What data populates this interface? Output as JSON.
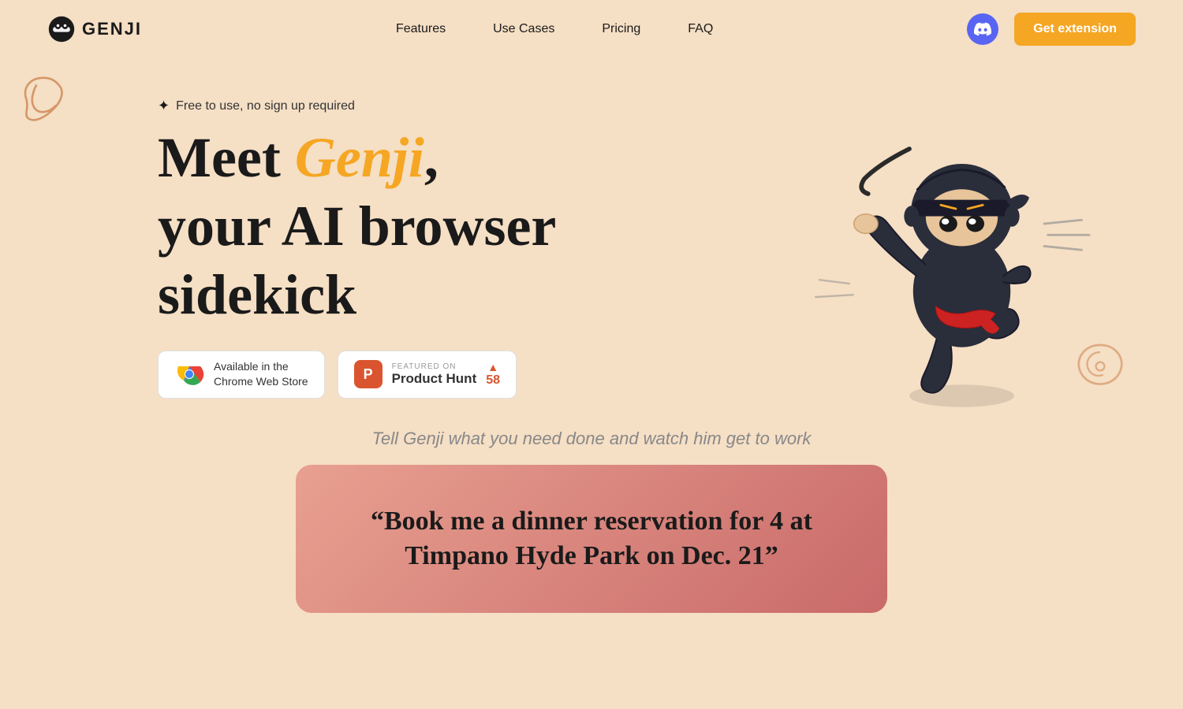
{
  "nav": {
    "logo_text": "GENJI",
    "links": [
      {
        "label": "Features",
        "id": "features"
      },
      {
        "label": "Use Cases",
        "id": "use-cases"
      },
      {
        "label": "Pricing",
        "id": "pricing"
      },
      {
        "label": "FAQ",
        "id": "faq"
      }
    ],
    "get_extension_label": "Get extension"
  },
  "hero": {
    "free_badge": "Free to use, no sign up required",
    "title_meet": "Meet ",
    "title_genji": "Genji",
    "title_comma": ",",
    "title_line2": "your AI browser",
    "title_line3": "sidekick"
  },
  "chrome_badge": {
    "line1": "Available in the",
    "line2": "Chrome Web Store"
  },
  "product_hunt": {
    "featured_label": "FEATURED ON",
    "name": "Product Hunt",
    "votes": "58",
    "icon_letter": "P"
  },
  "tagline": "Tell Genji what you need done and watch him get to work",
  "demo_card": {
    "text": "“Book me a dinner reservation for 4 at Timpano Hyde Park on Dec. 21”"
  },
  "colors": {
    "accent": "#F5A623",
    "background": "#f5dfc5",
    "discord": "#5865F2",
    "product_hunt": "#da552f"
  }
}
